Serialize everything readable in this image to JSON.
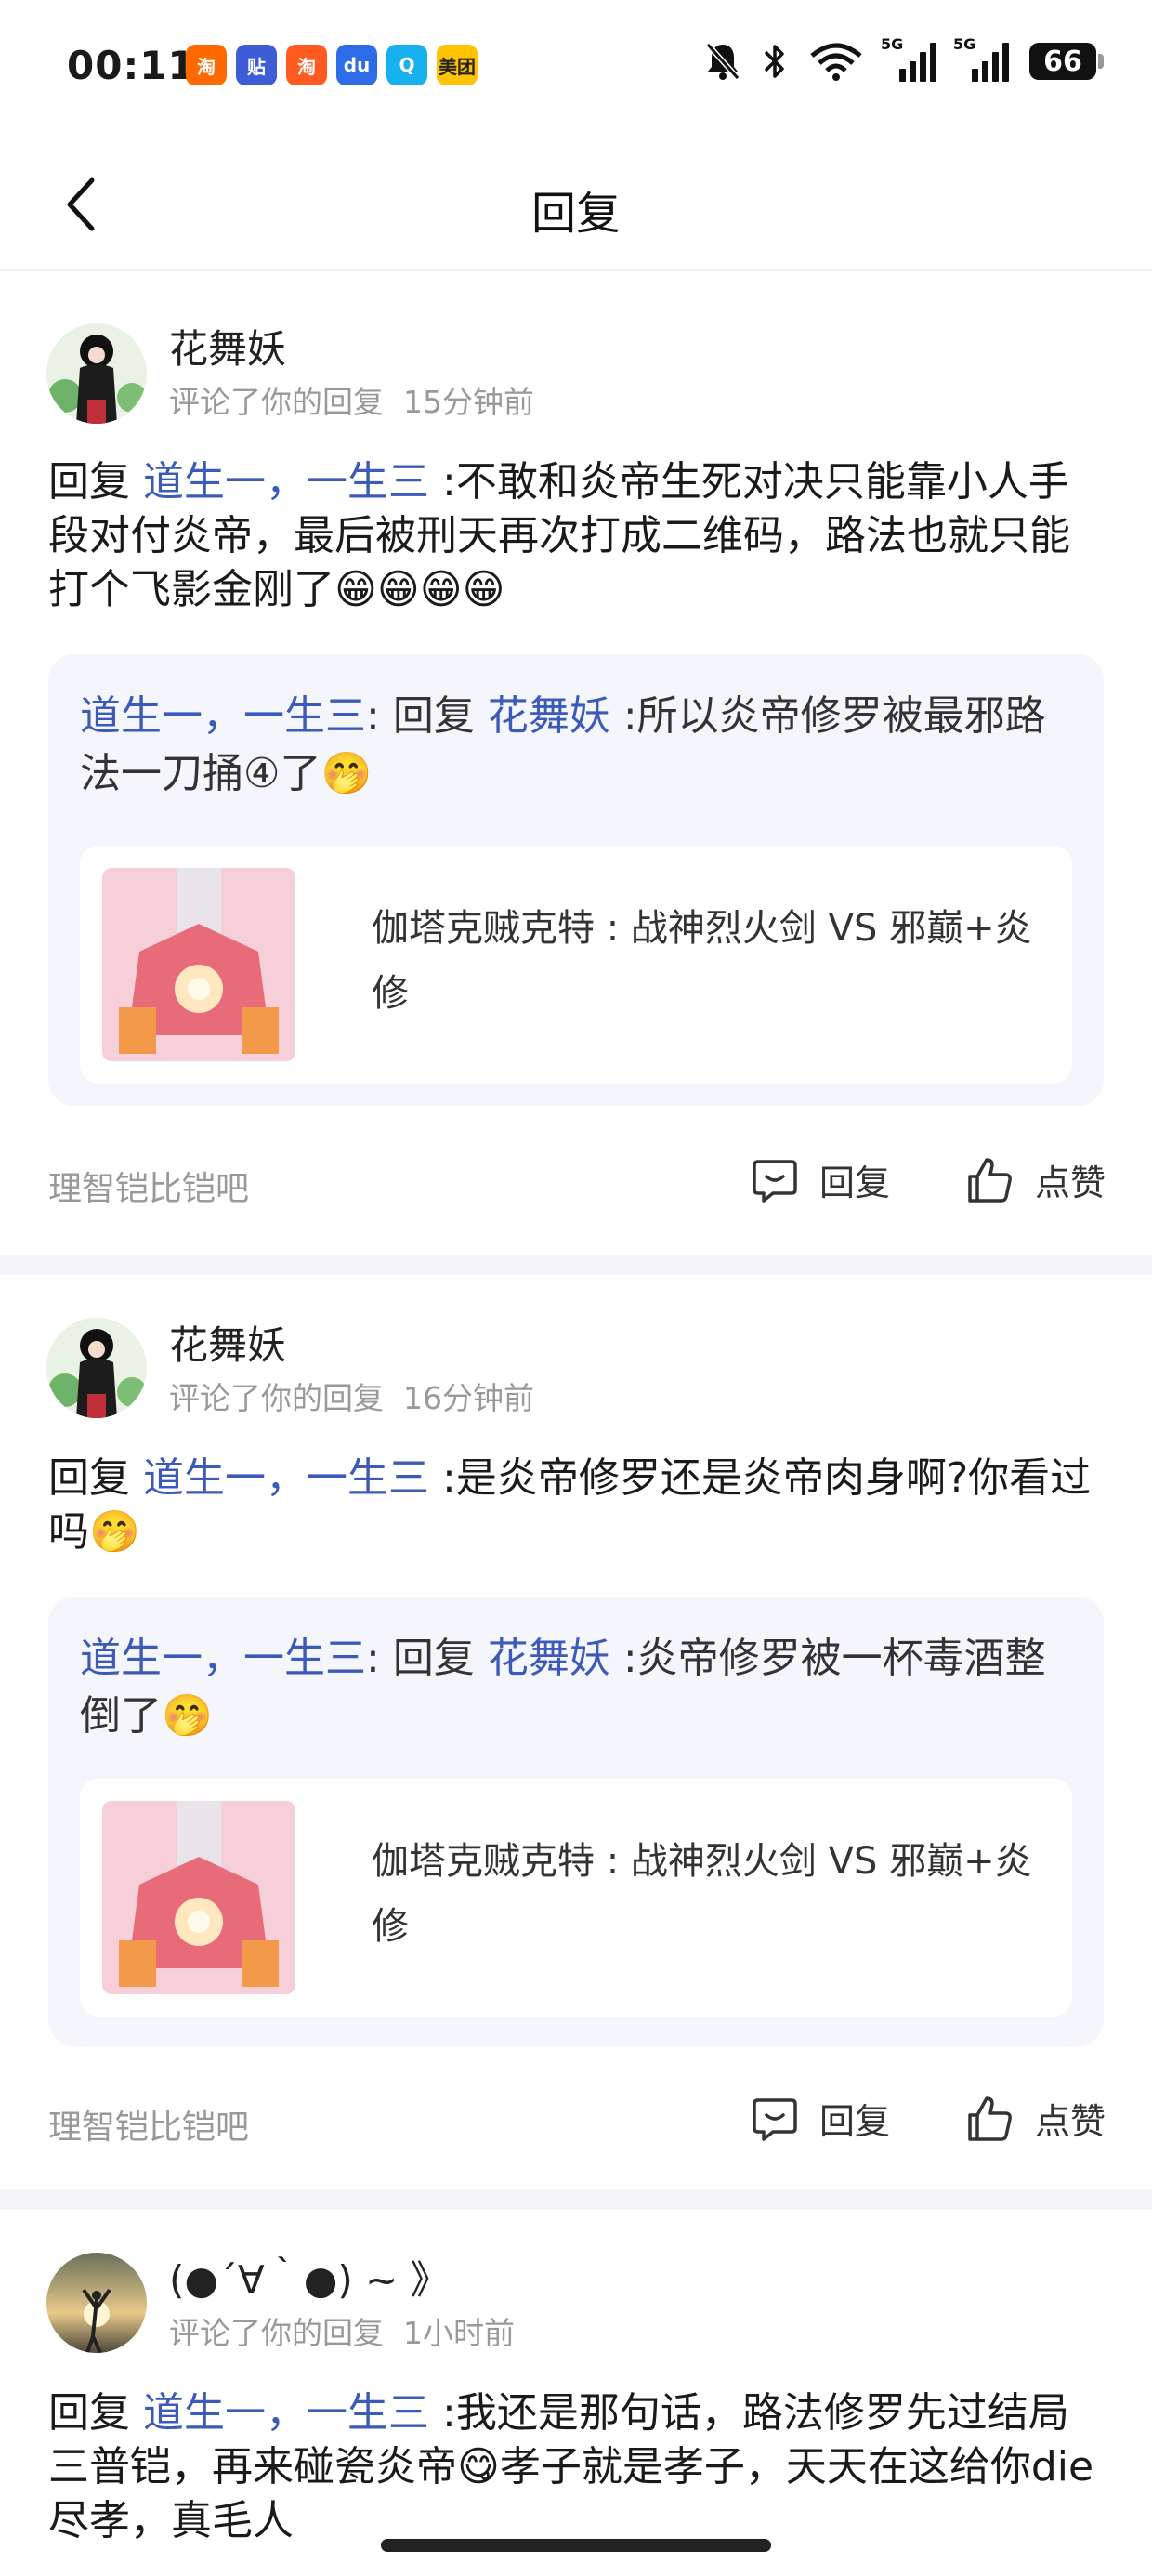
{
  "status_bar": {
    "time": "00:11",
    "app_icons": [
      {
        "name": "taobao-icon",
        "color": "#ff6a00",
        "glyph": "淘"
      },
      {
        "name": "tieba-icon",
        "color": "#3e5cd6",
        "glyph": "贴"
      },
      {
        "name": "xiaohongshu-icon",
        "color": "#ff5a1f",
        "glyph": "淘"
      },
      {
        "name": "baidu-icon",
        "color": "#2e6be6",
        "glyph": "du"
      },
      {
        "name": "qq-icon",
        "color": "#17b1f0",
        "glyph": "Q"
      },
      {
        "name": "meituan-icon",
        "color": "#ffc300",
        "glyph": "美团"
      }
    ],
    "network_1": "5G",
    "network_2": "5G",
    "battery": "66"
  },
  "header": {
    "title": "回复"
  },
  "items": [
    {
      "user": "花舞妖",
      "meta_action": "评论了你的回复",
      "meta_time": "15分钟前",
      "reply_prefix": "回复",
      "reply_target": "道生一，一生三",
      "reply_text": ":不敢和炎帝生死对决只能靠小人手段对付炎帝，最后被刑天再次打成二维码，路法也就只能打个飞影金刚了",
      "reply_emoji": "😁😁😁😁",
      "quote_author": "道生一，一生三",
      "quote_sep": ":",
      "quote_prefix": "回复",
      "quote_target": "花舞妖",
      "quote_text": ":所以炎帝修罗被最邪路法一刀捅④了",
      "quote_emoji": "🤭",
      "post_title": "伽塔克贼克特 : 战神烈火剑 VS 邪巅+炎修",
      "forum": "理智铠比铠吧",
      "reply_label": "回复",
      "like_label": "点赞"
    },
    {
      "user": "花舞妖",
      "meta_action": "评论了你的回复",
      "meta_time": "16分钟前",
      "reply_prefix": "回复",
      "reply_target": "道生一，一生三",
      "reply_text": ":是炎帝修罗还是炎帝肉身啊?你看过吗",
      "reply_emoji": "🤭",
      "quote_author": "道生一，一生三",
      "quote_sep": ":",
      "quote_prefix": "回复",
      "quote_target": "花舞妖",
      "quote_text": ":炎帝修罗被一杯毒酒整倒了",
      "quote_emoji": "🤭",
      "post_title": "伽塔克贼克特 : 战神烈火剑 VS 邪巅+炎修",
      "forum": "理智铠比铠吧",
      "reply_label": "回复",
      "like_label": "点赞"
    },
    {
      "user": "(●´∀｀●) ~ 》",
      "meta_action": "评论了你的回复",
      "meta_time": "1小时前",
      "reply_prefix": "回复",
      "reply_target": "道生一，一生三",
      "reply_text": ":我还是那句话，路法修罗先过结局三普铠，再来碰瓷炎帝",
      "reply_emoji": "😋",
      "reply_tail": "孝子就是孝子，天天在这给你die尽孝，真毛人"
    }
  ]
}
